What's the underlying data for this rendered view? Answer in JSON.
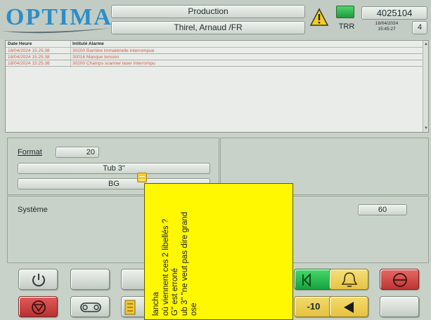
{
  "header": {
    "logo": "OPTIMA",
    "production": "Production",
    "user": "Thirel, Arnaud /FR",
    "machine_number": "4025104",
    "trr": "TRR",
    "date": "18/04/2024",
    "time": "15:45:27",
    "page": "4"
  },
  "alarms": {
    "col_date": "Date Heure",
    "col_label": "Intitulé Alarme",
    "rows": [
      {
        "date": "18/04/2024 15:25:38",
        "label": "30200 Barrière immatérielle interrompue"
      },
      {
        "date": "18/04/2024 15:25:38",
        "label": "30016 Manque tension"
      },
      {
        "date": "18/04/2024 15:25:38",
        "label": "30200 Champs scanner laser interrompu"
      }
    ]
  },
  "format": {
    "label": "Format",
    "value": "20",
    "product": "Tub 3\"",
    "variant": "BG"
  },
  "system": {
    "label": "Système",
    "value": "60"
  },
  "buttons": {
    "minus10": "-10"
  },
  "sticky_note": {
    "lines": [
      "ose",
      "ub 3\" \"ne veut pas dire grand",
      "G\" est erroné",
      "où viennent ces 2 libellés ?",
      "lancha"
    ]
  },
  "colors": {
    "alarm_text": "#d05a4e",
    "logo": "#2c8ec8",
    "sticky": "#fff800"
  }
}
